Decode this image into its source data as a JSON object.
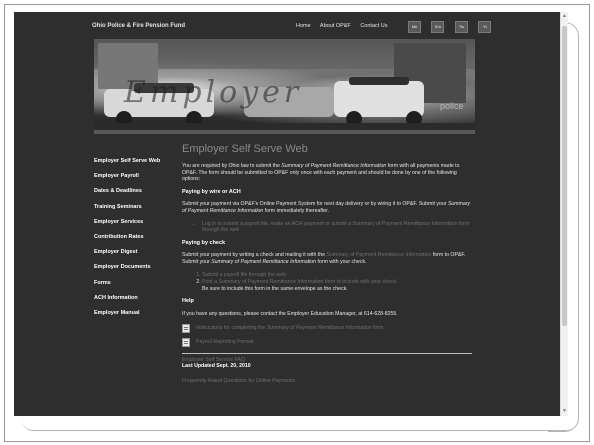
{
  "header": {
    "site_name": "Ohio Police & Fire Pension Fund",
    "nav": [
      "Home",
      "About OP&F",
      "Contact Us"
    ],
    "social": [
      "Me",
      "Em",
      "Tw",
      "Yt"
    ]
  },
  "banner": {
    "caption": "Employer",
    "watermark": "police"
  },
  "sidebar": {
    "items": [
      "Employer Self Serve Web",
      "Employer Payroll",
      "Dates & Deadlines",
      "Training Seminars",
      "Employer Services",
      "Contribution Rates",
      "Employer Digest",
      "Employer Documents",
      "Forms",
      "ACH Information",
      "Employer Manual"
    ]
  },
  "main": {
    "title": "Employer Self Serve Web",
    "intro": {
      "t1": "You are required by Ohio law to submit the ",
      "t2": "Summary of Payment Remittance Information",
      "t3": " form with all payments made to OP&F. The form should be submitted to OP&F only once with each payment and should be done by one of the following options:"
    },
    "wire": {
      "heading": "Paying by wire or ACH",
      "t1": "Submit your payment via OP&F's Online Payment System for next day delivery or by wiring it to OP&F. Submit your ",
      "t2": "Summary of Payment Remittance Information",
      "t3": " form immediately thereafter.",
      "bullet": "Log in to submit a payroll file, make an ACH payment or submit a Summary of Payment Remittance Information form through the web"
    },
    "check": {
      "heading": "Paying by check",
      "t1": "Submit your payment by writing a check and mailing it with the ",
      "t2": "Summary of Payment Remittance Information",
      "t3": " form to OP&F.  Submit your ",
      "t4": "Summary of Payment Remittance Information",
      "t5": " form with your check.",
      "steps": [
        "Submit a payroll file through the web",
        "Print a Summary of Payment Remittance Information form to include with your check"
      ],
      "note": "Be sure to include this form in the same envelope as the check."
    },
    "help": {
      "heading": "Help",
      "text": "If you have any questions, please contact the Employer Education Manager, at 614-628-8255."
    },
    "docs": [
      {
        "t1": "Instructions for completing the ",
        "t2": "Summary of Payment Remittance Information",
        "t3": " form"
      },
      {
        "t1": "Payroll Reporting Format"
      }
    ],
    "faq": "Employer Self Service FAQ",
    "last_updated": "Last Updated Sept. 20, 2010",
    "faq2": "Frequently Asked Questions for Online Payments"
  }
}
